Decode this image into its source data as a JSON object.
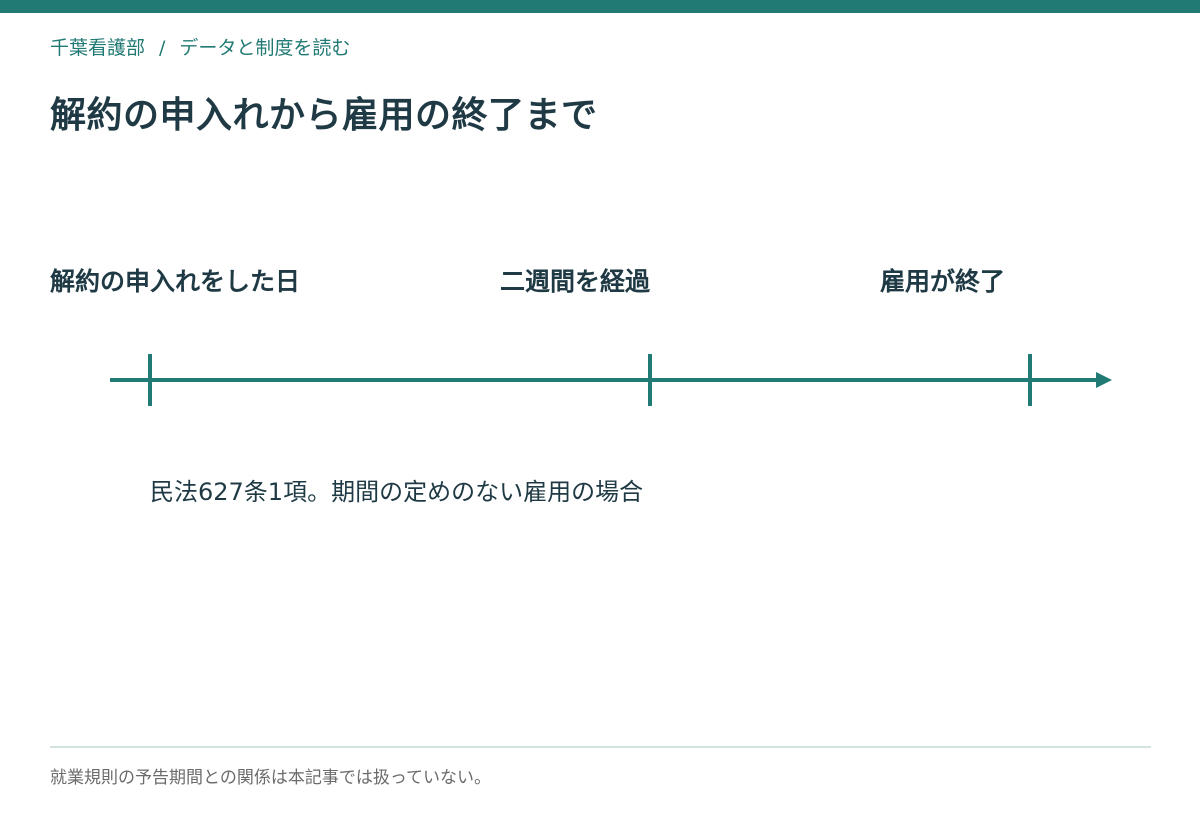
{
  "breadcrumb": {
    "site": "千葉看護部",
    "separator": "/",
    "section": "データと制度を読む"
  },
  "title": "解約の申入れから雇用の終了まで",
  "timeline": {
    "color": "#217a74",
    "milestones": [
      {
        "label": "解約の申入れをした日"
      },
      {
        "label": "二週間を経過"
      },
      {
        "label": "雇用が終了"
      }
    ],
    "note": "民法627条1項。期間の定めのない雇用の場合"
  },
  "footnote": "就業規則の予告期間との関係は本記事では扱っていない。"
}
